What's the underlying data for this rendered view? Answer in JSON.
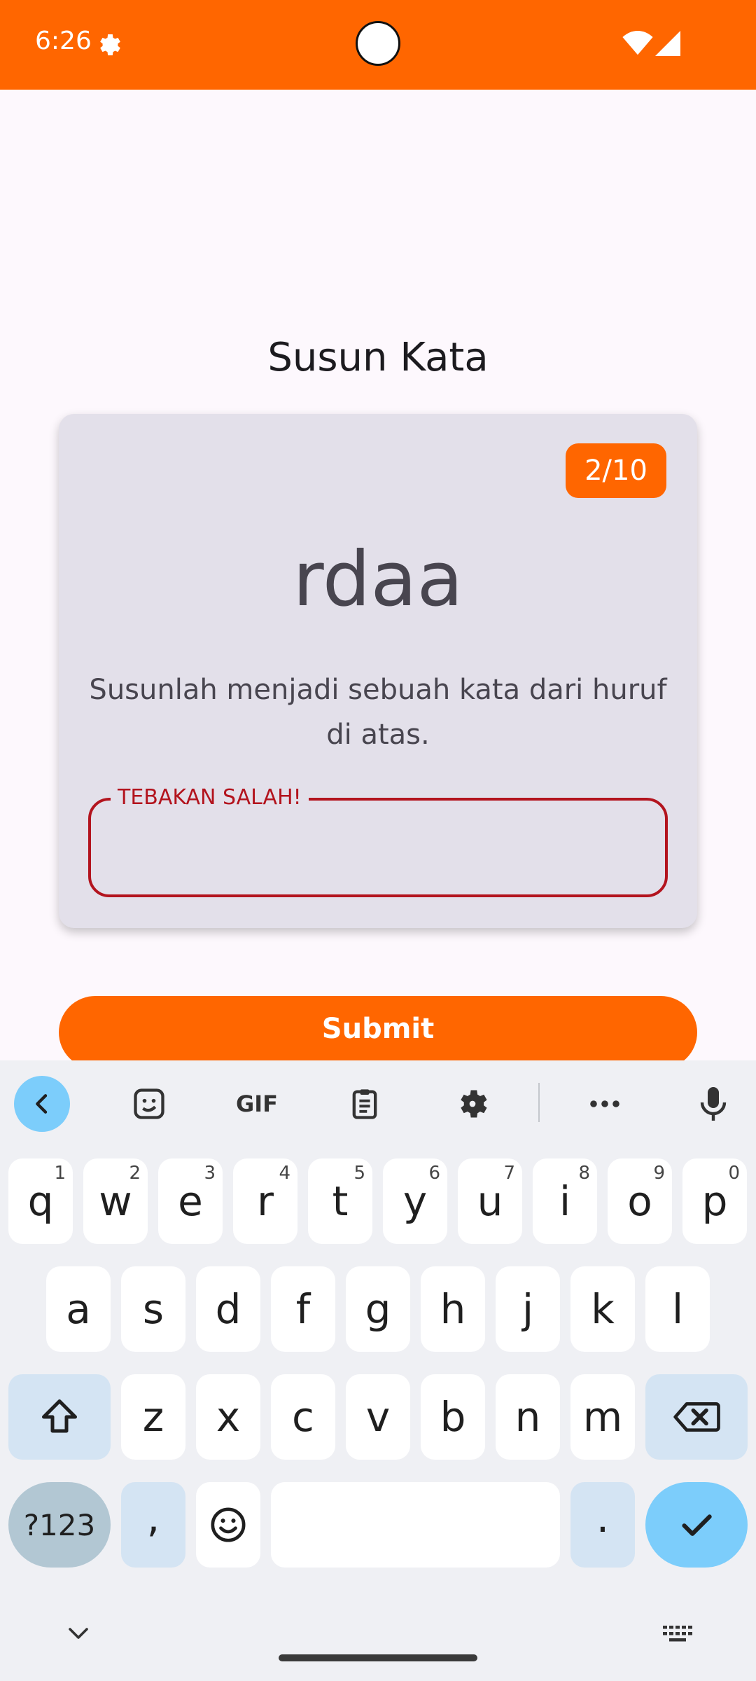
{
  "status_bar": {
    "time": "6:26"
  },
  "screen": {
    "title": "Susun Kata",
    "counter": "2/10",
    "scrambled_word": "rdaa",
    "instruction": "Susunlah menjadi sebuah kata dari huruf di atas.",
    "answer_label": "TEBAKAN SALAH!",
    "answer_value": "",
    "submit_label": "Submit"
  },
  "keyboard": {
    "toolbar": [
      "back-icon",
      "sticker-icon",
      "GIF",
      "clipboard-icon",
      "gear-icon",
      "more-icon",
      "microphone-icon"
    ],
    "row1": [
      {
        "key": "q",
        "hint": "1"
      },
      {
        "key": "w",
        "hint": "2"
      },
      {
        "key": "e",
        "hint": "3"
      },
      {
        "key": "r",
        "hint": "4"
      },
      {
        "key": "t",
        "hint": "5"
      },
      {
        "key": "y",
        "hint": "6"
      },
      {
        "key": "u",
        "hint": "7"
      },
      {
        "key": "i",
        "hint": "8"
      },
      {
        "key": "o",
        "hint": "9"
      },
      {
        "key": "p",
        "hint": "0"
      }
    ],
    "row2": [
      "a",
      "s",
      "d",
      "f",
      "g",
      "h",
      "j",
      "k",
      "l"
    ],
    "row3": [
      "z",
      "x",
      "c",
      "v",
      "b",
      "n",
      "m"
    ],
    "symbols_label": "?123",
    "comma_label": ",",
    "period_label": ".",
    "colors": {
      "accent": "#ff6600",
      "error": "#b3141e",
      "key_action": "#7ccdfb"
    }
  }
}
